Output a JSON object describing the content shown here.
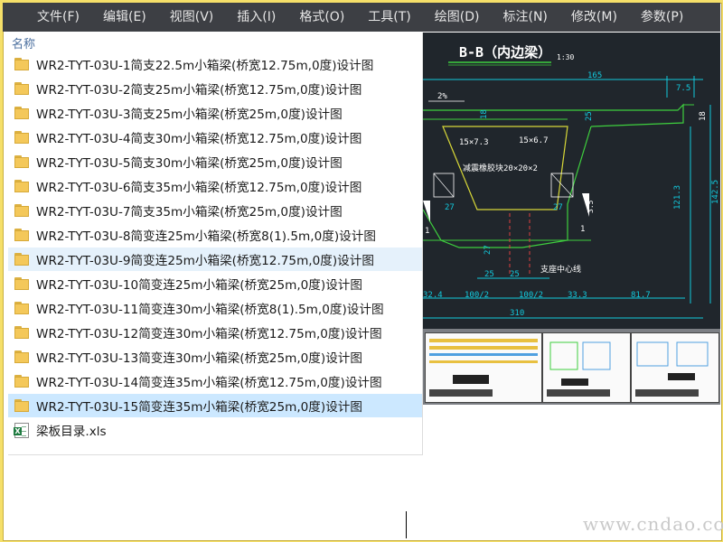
{
  "menu": {
    "items": [
      "文件(F)",
      "编辑(E)",
      "视图(V)",
      "插入(I)",
      "格式(O)",
      "工具(T)",
      "绘图(D)",
      "标注(N)",
      "修改(M)",
      "参数(P)"
    ]
  },
  "file_list": {
    "column_header": "名称",
    "folders": [
      "WR2-TYT-03U-1简支22.5m小箱梁(桥宽12.75m,0度)设计图",
      "WR2-TYT-03U-2简支25m小箱梁(桥宽12.75m,0度)设计图",
      "WR2-TYT-03U-3简支25m小箱梁(桥宽25m,0度)设计图",
      "WR2-TYT-03U-4简支30m小箱梁(桥宽12.75m,0度)设计图",
      "WR2-TYT-03U-5简支30m小箱梁(桥宽25m,0度)设计图",
      "WR2-TYT-03U-6简支35m小箱梁(桥宽12.75m,0度)设计图",
      "WR2-TYT-03U-7简支35m小箱梁(桥宽25m,0度)设计图",
      "WR2-TYT-03U-8简变连25m小箱梁(桥宽8(1).5m,0度)设计图",
      "WR2-TYT-03U-9简变连25m小箱梁(桥宽12.75m,0度)设计图",
      "WR2-TYT-03U-10简变连25m小箱梁(桥宽25m,0度)设计图",
      "WR2-TYT-03U-11简变连30m小箱梁(桥宽8(1).5m,0度)设计图",
      "WR2-TYT-03U-12简变连30m小箱梁(桥宽12.75m,0度)设计图",
      "WR2-TYT-03U-13简变连30m小箱梁(桥宽25m,0度)设计图",
      "WR2-TYT-03U-14简变连35m小箱梁(桥宽12.75m,0度)设计图",
      "WR2-TYT-03U-15简变连35m小箱梁(桥宽25m,0度)设计图"
    ],
    "file": "梁板目录.xls",
    "hovered_index": 8,
    "selected_index": 14
  },
  "cad_drawing": {
    "title": "B-B（内边梁）",
    "scale": "1:30",
    "dims_top": [
      "165",
      "7.5",
      "2%"
    ],
    "dims_side": [
      "18",
      "25",
      "18",
      "3.5",
      "27",
      "27",
      "27",
      "121.3",
      "142.5"
    ],
    "strand_labels": [
      "15×7.3",
      "15×6.7"
    ],
    "note": "减震橡胶块20×20×2",
    "support_label": "支座中心线",
    "dims_bottom": [
      "25",
      "25",
      "32.4",
      "100/2",
      "100/2",
      "33.3",
      "81.7",
      "310"
    ],
    "slope_marks": [
      "1",
      "1"
    ]
  },
  "watermark": "www.cndao.com",
  "colors": {
    "menubar": "#3d3f44",
    "cad_background": "#20262c",
    "dimension": "#12c9dd",
    "outline": "#d8d838",
    "green": "#3ecf3e",
    "selection": "#cce8ff",
    "hover": "#e5f1fb"
  }
}
